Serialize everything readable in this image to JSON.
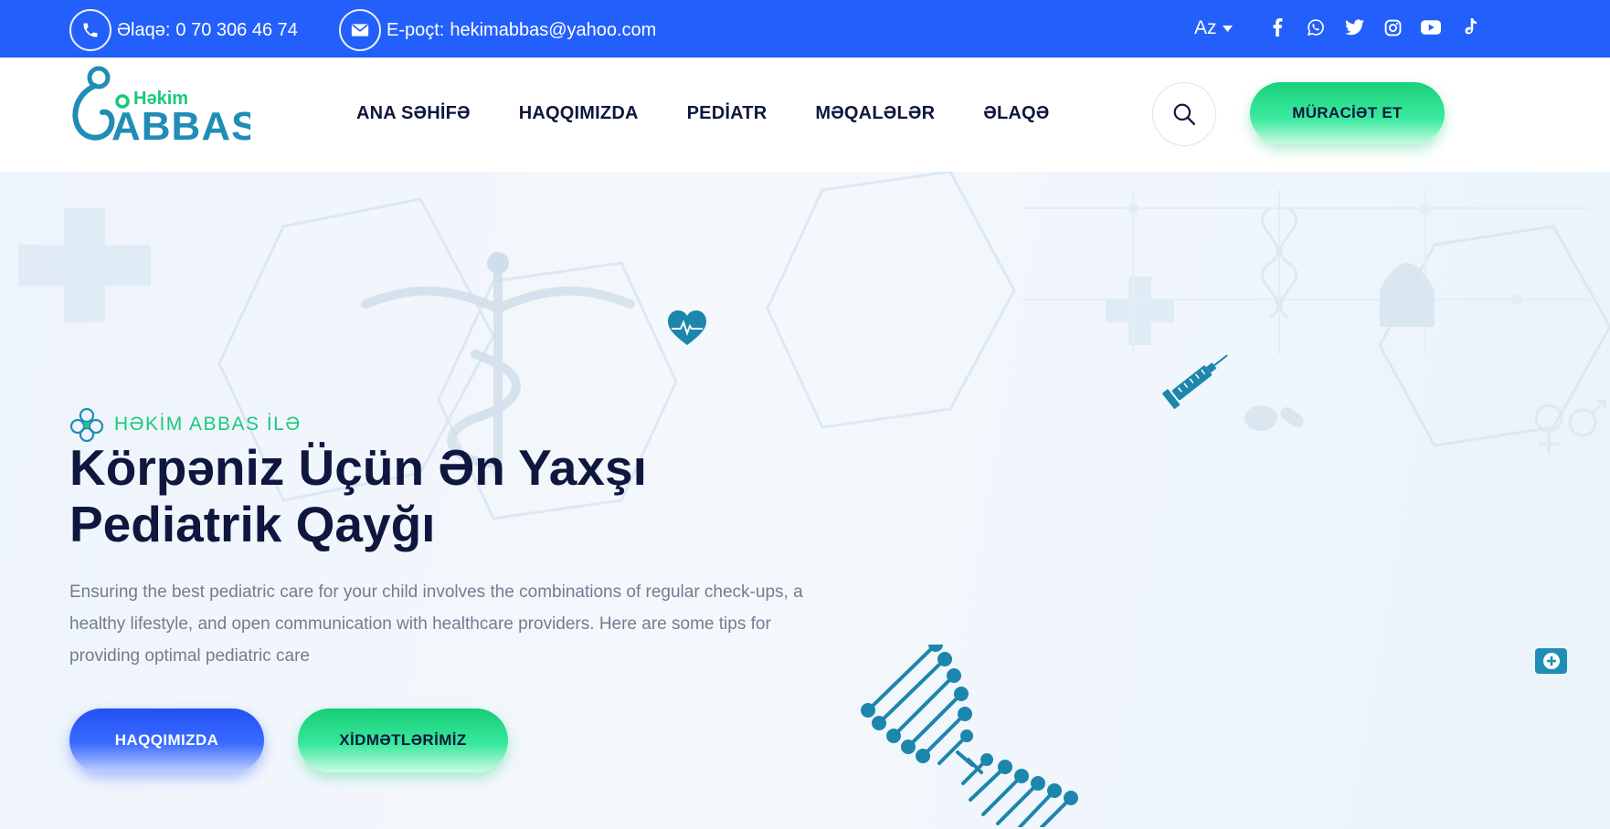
{
  "topbar": {
    "phone_label": "Əlaqə:",
    "phone": "0 70 306 46 74",
    "email_label": "E-poçt:",
    "email": "hekimabbas@yahoo.com",
    "language": "Az",
    "socials": [
      "facebook-icon",
      "whatsapp-icon",
      "twitter-icon",
      "instagram-icon",
      "youtube-icon",
      "tiktok-icon"
    ]
  },
  "logo": {
    "top": "Həkim",
    "main": "ABBAS"
  },
  "nav": {
    "items": [
      "ANA SƏHİFƏ",
      "HAQQIMIZDA",
      "PEDİATR",
      "MƏQALƏLƏR",
      "ƏLAQƏ"
    ],
    "cta": "MÜRACİƏT ET"
  },
  "hero": {
    "tagline": "HƏKİM ABBAS İLƏ",
    "title_line1": "Körpəniz Üçün Ən Yaxşı",
    "title_line2": "Pediatrik Qayğı",
    "description": "Ensuring the best pediatric care for your child involves the combinations of regular check-ups, a healthy lifestyle, and open communication with healthcare providers. Here are some tips for providing optimal pediatric care",
    "button_about": "HAQQIMIZDA",
    "button_services": "XİDMƏTLƏRİMİZ"
  },
  "colors": {
    "primary": "#2360fb",
    "accent": "#19c97a",
    "dark": "#0f173f",
    "teal": "#1f8db5"
  }
}
